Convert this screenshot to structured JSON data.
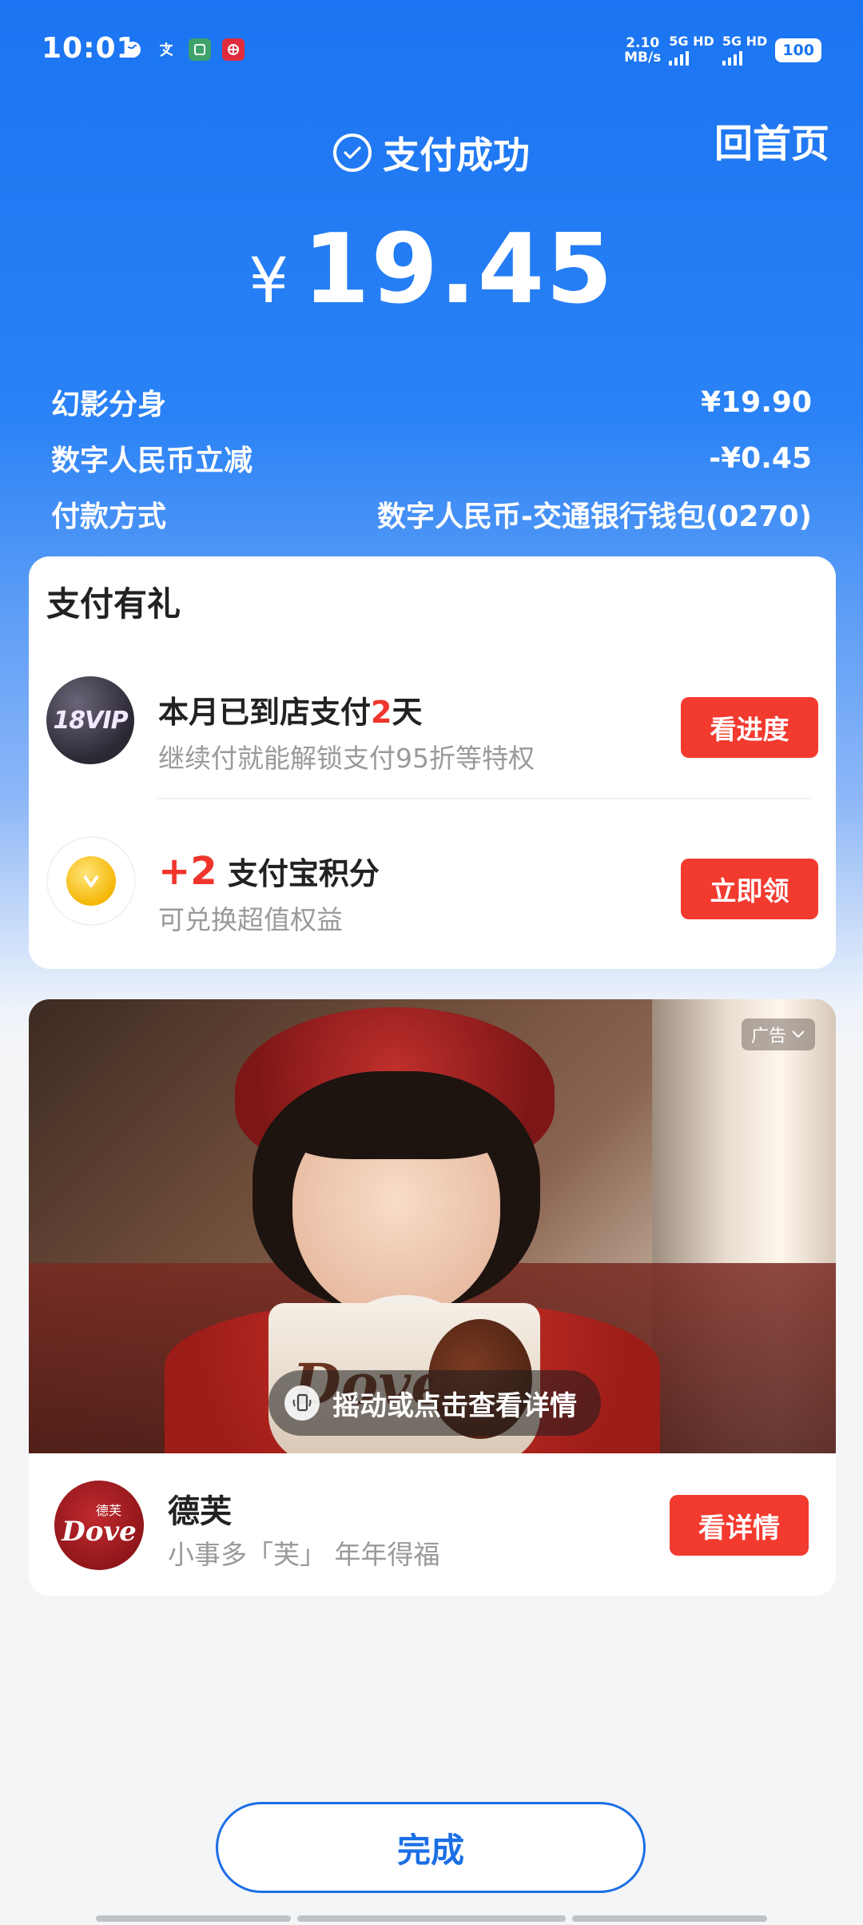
{
  "status_bar": {
    "time": "10:01",
    "speed_value": "2.10",
    "speed_unit": "MB/s",
    "net1": "5G HD",
    "net2": "5G HD",
    "battery": "100"
  },
  "header": {
    "home_label": "回首页",
    "success_label": "支付成功",
    "currency_symbol": "¥",
    "amount": "19.45"
  },
  "details": [
    {
      "label": "幻影分身",
      "value": "¥19.90"
    },
    {
      "label": "数字人民币立减",
      "value": "-¥0.45"
    },
    {
      "label": "付款方式",
      "value": "数字人民币-交通银行钱包(0270)"
    }
  ],
  "gift": {
    "title": "支付有礼",
    "items": [
      {
        "badge": "18VIP",
        "main_prefix": "本月已到店支付",
        "main_highlight": "2",
        "main_suffix": "天",
        "sub": "继续付就能解锁支付95折等特权",
        "button": "看进度"
      },
      {
        "main_highlight": "+2",
        "main_suffix": " 支付宝积分",
        "sub": "可兑换超值权益",
        "button": "立即领"
      }
    ]
  },
  "ad": {
    "tag": "广告",
    "shake_text": "摇动或点击查看详情",
    "product_logo": "Dove",
    "brand_logo_zh": "德芙",
    "brand_logo_en": "Dove",
    "brand_name": "德芙",
    "slogan": "小事多「芙」 年年得福",
    "button": "看详情"
  },
  "footer": {
    "done_label": "完成"
  },
  "colors": {
    "primary_blue": "#1b74f1",
    "accent_red": "#f23a2f",
    "done_blue": "#1b6fe6"
  }
}
